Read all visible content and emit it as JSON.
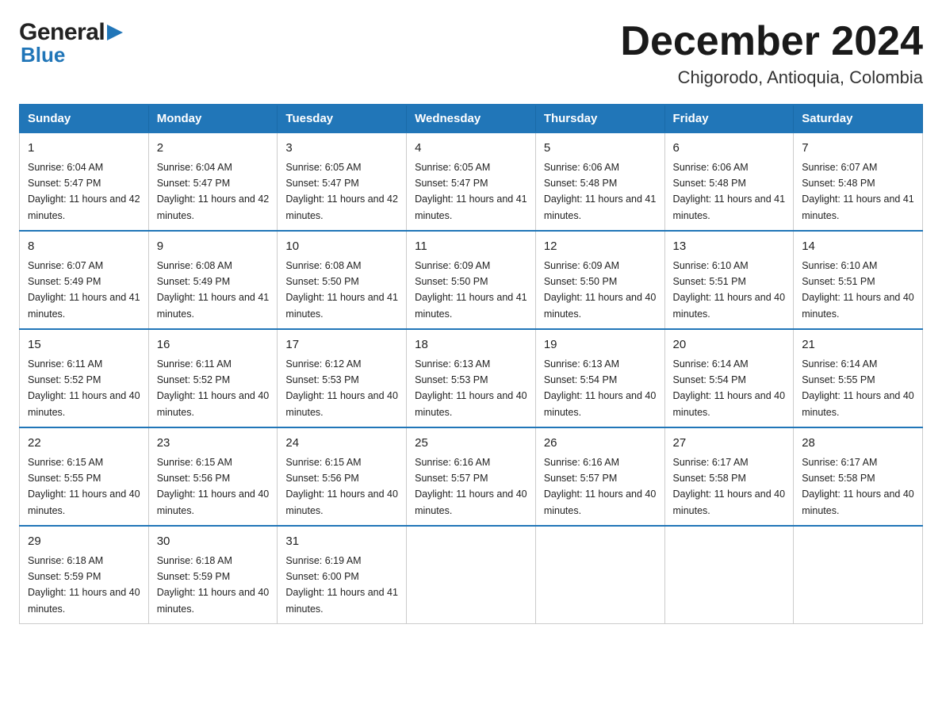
{
  "header": {
    "logo_general": "General",
    "logo_blue": "Blue",
    "month_title": "December 2024",
    "location": "Chigorodo, Antioquia, Colombia"
  },
  "days_of_week": [
    "Sunday",
    "Monday",
    "Tuesday",
    "Wednesday",
    "Thursday",
    "Friday",
    "Saturday"
  ],
  "weeks": [
    [
      {
        "day": "1",
        "sunrise": "6:04 AM",
        "sunset": "5:47 PM",
        "daylight": "11 hours and 42 minutes."
      },
      {
        "day": "2",
        "sunrise": "6:04 AM",
        "sunset": "5:47 PM",
        "daylight": "11 hours and 42 minutes."
      },
      {
        "day": "3",
        "sunrise": "6:05 AM",
        "sunset": "5:47 PM",
        "daylight": "11 hours and 42 minutes."
      },
      {
        "day": "4",
        "sunrise": "6:05 AM",
        "sunset": "5:47 PM",
        "daylight": "11 hours and 41 minutes."
      },
      {
        "day": "5",
        "sunrise": "6:06 AM",
        "sunset": "5:48 PM",
        "daylight": "11 hours and 41 minutes."
      },
      {
        "day": "6",
        "sunrise": "6:06 AM",
        "sunset": "5:48 PM",
        "daylight": "11 hours and 41 minutes."
      },
      {
        "day": "7",
        "sunrise": "6:07 AM",
        "sunset": "5:48 PM",
        "daylight": "11 hours and 41 minutes."
      }
    ],
    [
      {
        "day": "8",
        "sunrise": "6:07 AM",
        "sunset": "5:49 PM",
        "daylight": "11 hours and 41 minutes."
      },
      {
        "day": "9",
        "sunrise": "6:08 AM",
        "sunset": "5:49 PM",
        "daylight": "11 hours and 41 minutes."
      },
      {
        "day": "10",
        "sunrise": "6:08 AM",
        "sunset": "5:50 PM",
        "daylight": "11 hours and 41 minutes."
      },
      {
        "day": "11",
        "sunrise": "6:09 AM",
        "sunset": "5:50 PM",
        "daylight": "11 hours and 41 minutes."
      },
      {
        "day": "12",
        "sunrise": "6:09 AM",
        "sunset": "5:50 PM",
        "daylight": "11 hours and 40 minutes."
      },
      {
        "day": "13",
        "sunrise": "6:10 AM",
        "sunset": "5:51 PM",
        "daylight": "11 hours and 40 minutes."
      },
      {
        "day": "14",
        "sunrise": "6:10 AM",
        "sunset": "5:51 PM",
        "daylight": "11 hours and 40 minutes."
      }
    ],
    [
      {
        "day": "15",
        "sunrise": "6:11 AM",
        "sunset": "5:52 PM",
        "daylight": "11 hours and 40 minutes."
      },
      {
        "day": "16",
        "sunrise": "6:11 AM",
        "sunset": "5:52 PM",
        "daylight": "11 hours and 40 minutes."
      },
      {
        "day": "17",
        "sunrise": "6:12 AM",
        "sunset": "5:53 PM",
        "daylight": "11 hours and 40 minutes."
      },
      {
        "day": "18",
        "sunrise": "6:13 AM",
        "sunset": "5:53 PM",
        "daylight": "11 hours and 40 minutes."
      },
      {
        "day": "19",
        "sunrise": "6:13 AM",
        "sunset": "5:54 PM",
        "daylight": "11 hours and 40 minutes."
      },
      {
        "day": "20",
        "sunrise": "6:14 AM",
        "sunset": "5:54 PM",
        "daylight": "11 hours and 40 minutes."
      },
      {
        "day": "21",
        "sunrise": "6:14 AM",
        "sunset": "5:55 PM",
        "daylight": "11 hours and 40 minutes."
      }
    ],
    [
      {
        "day": "22",
        "sunrise": "6:15 AM",
        "sunset": "5:55 PM",
        "daylight": "11 hours and 40 minutes."
      },
      {
        "day": "23",
        "sunrise": "6:15 AM",
        "sunset": "5:56 PM",
        "daylight": "11 hours and 40 minutes."
      },
      {
        "day": "24",
        "sunrise": "6:15 AM",
        "sunset": "5:56 PM",
        "daylight": "11 hours and 40 minutes."
      },
      {
        "day": "25",
        "sunrise": "6:16 AM",
        "sunset": "5:57 PM",
        "daylight": "11 hours and 40 minutes."
      },
      {
        "day": "26",
        "sunrise": "6:16 AM",
        "sunset": "5:57 PM",
        "daylight": "11 hours and 40 minutes."
      },
      {
        "day": "27",
        "sunrise": "6:17 AM",
        "sunset": "5:58 PM",
        "daylight": "11 hours and 40 minutes."
      },
      {
        "day": "28",
        "sunrise": "6:17 AM",
        "sunset": "5:58 PM",
        "daylight": "11 hours and 40 minutes."
      }
    ],
    [
      {
        "day": "29",
        "sunrise": "6:18 AM",
        "sunset": "5:59 PM",
        "daylight": "11 hours and 40 minutes."
      },
      {
        "day": "30",
        "sunrise": "6:18 AM",
        "sunset": "5:59 PM",
        "daylight": "11 hours and 40 minutes."
      },
      {
        "day": "31",
        "sunrise": "6:19 AM",
        "sunset": "6:00 PM",
        "daylight": "11 hours and 41 minutes."
      },
      null,
      null,
      null,
      null
    ]
  ],
  "labels": {
    "sunrise": "Sunrise:",
    "sunset": "Sunset:",
    "daylight": "Daylight:"
  }
}
